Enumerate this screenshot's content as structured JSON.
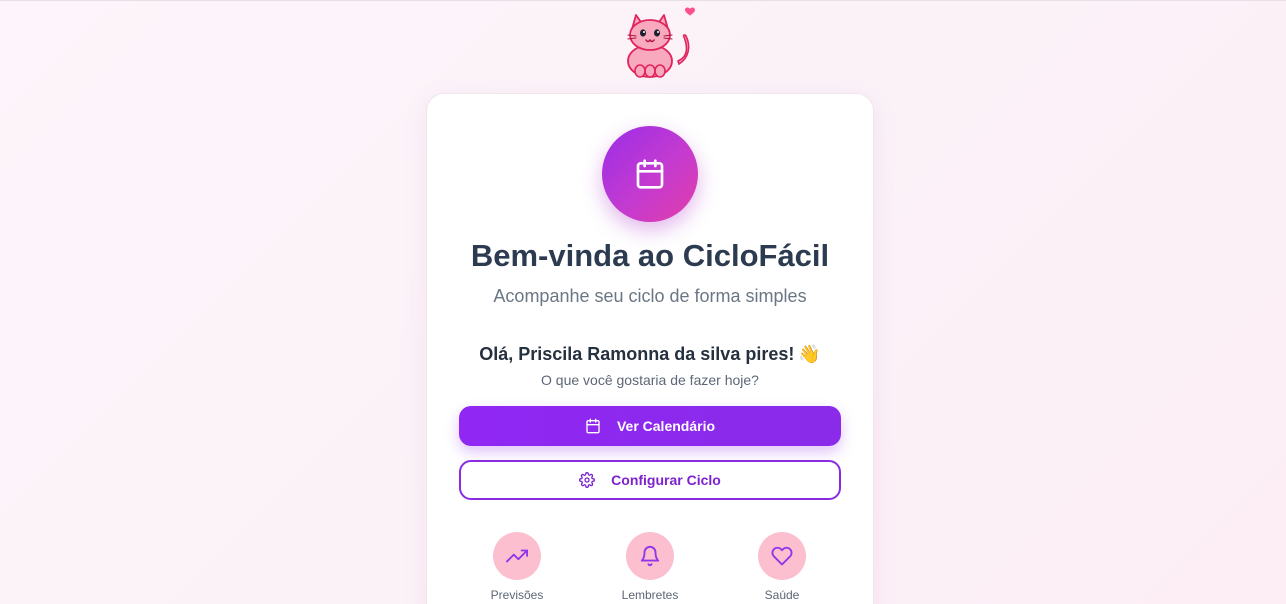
{
  "app": {
    "mascot": "cat-heart-mascot"
  },
  "hero": {
    "icon": "calendar-icon",
    "title": "Bem-vinda ao CicloFácil",
    "subtitle": "Acompanhe seu ciclo de forma simples"
  },
  "user": {
    "greeting": "Olá, Priscila Ramonna da silva pires!",
    "wave": "👋",
    "question": "O que você gostaria de fazer hoje?"
  },
  "actions": {
    "primary_label": "Ver Calendário",
    "primary_icon": "calendar-icon",
    "secondary_label": "Configurar Ciclo",
    "secondary_icon": "gear-icon"
  },
  "features": [
    {
      "label": "Previsões",
      "icon": "trending-up-icon"
    },
    {
      "label": "Lembretes",
      "icon": "bell-icon"
    },
    {
      "label": "Saúde",
      "icon": "heart-icon"
    }
  ],
  "colors": {
    "primary": "#9027f3",
    "accent_pink": "#e23ca8",
    "feature_bg": "#fbbfcf",
    "title": "#2d3b50"
  }
}
